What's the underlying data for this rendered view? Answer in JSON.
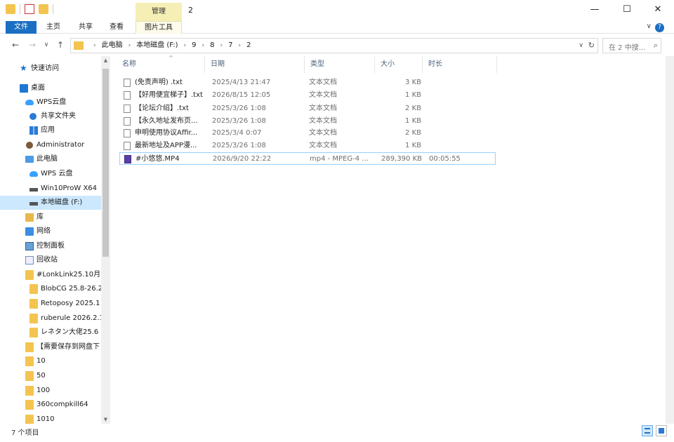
{
  "titlebar": {
    "context_tab": "管理",
    "title": "2",
    "minimize": "—",
    "maximize": "☐",
    "close": "✕"
  },
  "ribbon": {
    "tabs": [
      "文件",
      "主页",
      "共享",
      "查看",
      "图片工具"
    ],
    "expand_icon": "∨",
    "help": "?"
  },
  "nav": {
    "back": "←",
    "forward": "→",
    "recent": "∨",
    "up": "↑",
    "breadcrumb": [
      "此电脑",
      "本地磁盘 (F:)",
      "9",
      "8",
      "7",
      "2"
    ],
    "refresh": "↻",
    "dropdown": "∨"
  },
  "search": {
    "placeholder": "在 2 中搜...",
    "icon": "⌕"
  },
  "sidebar": {
    "items": [
      {
        "label": "快速访问",
        "icon": "star-icon"
      },
      {
        "label": "桌面",
        "icon": "desktop-icon"
      },
      {
        "label": "WPS云盘",
        "icon": "cloud-icon"
      },
      {
        "label": "共享文件夹",
        "icon": "share-icon"
      },
      {
        "label": "应用",
        "icon": "apps-icon"
      },
      {
        "label": "Administrator",
        "icon": "user-icon"
      },
      {
        "label": "此电脑",
        "icon": "pc-icon"
      },
      {
        "label": "WPS 云盘",
        "icon": "cloud-icon"
      },
      {
        "label": "Win10ProW X64",
        "icon": "drive-icon"
      },
      {
        "label": "本地磁盘 (F:)",
        "icon": "drive-icon"
      },
      {
        "label": "库",
        "icon": "library-icon"
      },
      {
        "label": "网络",
        "icon": "network-icon"
      },
      {
        "label": "控制面板",
        "icon": "control-panel-icon"
      },
      {
        "label": "回收站",
        "icon": "recycle-bin-icon"
      },
      {
        "label": "#LonkLink25.10月",
        "icon": "folder-icon"
      },
      {
        "label": "BlobCG 25.8-26.2",
        "icon": "folder-icon"
      },
      {
        "label": "Retoposy 2025.1",
        "icon": "folder-icon"
      },
      {
        "label": "ruberule 2026.2.1",
        "icon": "folder-icon"
      },
      {
        "label": "レネタン大佬25.6",
        "icon": "folder-icon"
      },
      {
        "label": "【需要保存到网盘下",
        "icon": "folder-icon"
      },
      {
        "label": "10",
        "icon": "folder-icon"
      },
      {
        "label": "50",
        "icon": "folder-icon"
      },
      {
        "label": "100",
        "icon": "folder-icon"
      },
      {
        "label": "360compkill64",
        "icon": "folder-icon"
      },
      {
        "label": "1010",
        "icon": "folder-icon"
      }
    ],
    "selected": "本地磁盘 (F:)"
  },
  "columns": {
    "name": "名称",
    "date": "日期",
    "type": "类型",
    "size": "大小",
    "duration": "时长",
    "sort_caret": "^"
  },
  "files": [
    {
      "name": "(免责声明) .txt",
      "date": "2025/4/13 21:47",
      "type": "文本文档",
      "size": "3 KB",
      "duration": "",
      "icon": "text-file-icon"
    },
    {
      "name": "【好用便宜梯子】.txt",
      "date": "2026/8/15 12:05",
      "type": "文本文档",
      "size": "1 KB",
      "duration": "",
      "icon": "text-file-icon"
    },
    {
      "name": "【论坛介绍】.txt",
      "date": "2025/3/26 1:08",
      "type": "文本文档",
      "size": "2 KB",
      "duration": "",
      "icon": "text-file-icon"
    },
    {
      "name": "【永久地址发布页...",
      "date": "2025/3/26 1:08",
      "type": "文本文档",
      "size": "1 KB",
      "duration": "",
      "icon": "text-file-icon"
    },
    {
      "name": "申明使用协议Affir...",
      "date": "2025/3/4 0:07",
      "type": "文本文档",
      "size": "2 KB",
      "duration": "",
      "icon": "text-file-icon"
    },
    {
      "name": "最新地址及APP漫...",
      "date": "2025/3/26 1:08",
      "type": "文本文档",
      "size": "1 KB",
      "duration": "",
      "icon": "text-file-icon"
    },
    {
      "name": "#小悠悠.MP4",
      "date": "2026/9/20 22:22",
      "type": "mp4 - MPEG-4 ...",
      "size": "289,390 KB",
      "duration": "00:05:55",
      "icon": "video-file-icon"
    }
  ],
  "status": {
    "count": "7 个项目"
  }
}
